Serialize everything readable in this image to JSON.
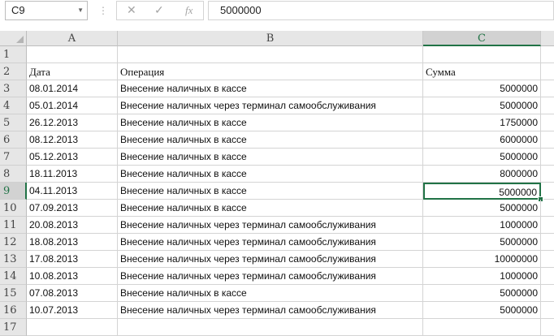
{
  "formula_bar": {
    "name_box": "C9",
    "cancel_icon": "✕",
    "enter_icon": "✓",
    "fx_label": "fx",
    "formula_value": "5000000"
  },
  "columns": [
    "A",
    "B",
    "C"
  ],
  "selected": {
    "col": "C",
    "row": 9
  },
  "rows": [
    {
      "n": "1",
      "date": "",
      "op": "",
      "sum": ""
    },
    {
      "n": "2",
      "date": "Дата",
      "op": "Операция",
      "sum": "Сумма"
    },
    {
      "n": "3",
      "date": "08.01.2014",
      "op": "Внесение наличных в кассе",
      "sum": "5000000"
    },
    {
      "n": "4",
      "date": "05.01.2014",
      "op": "Внесение наличных через терминал самообслуживания",
      "sum": "5000000"
    },
    {
      "n": "5",
      "date": "26.12.2013",
      "op": "Внесение наличных в кассе",
      "sum": "1750000"
    },
    {
      "n": "6",
      "date": "08.12.2013",
      "op": "Внесение наличных в кассе",
      "sum": "6000000"
    },
    {
      "n": "7",
      "date": "05.12.2013",
      "op": "Внесение наличных в кассе",
      "sum": "5000000"
    },
    {
      "n": "8",
      "date": "18.11.2013",
      "op": "Внесение наличных в кассе",
      "sum": "8000000"
    },
    {
      "n": "9",
      "date": "04.11.2013",
      "op": "Внесение наличных в кассе",
      "sum": "5000000"
    },
    {
      "n": "10",
      "date": "07.09.2013",
      "op": "Внесение наличных в кассе",
      "sum": "5000000"
    },
    {
      "n": "11",
      "date": "20.08.2013",
      "op": "Внесение наличных через терминал самообслуживания",
      "sum": "1000000"
    },
    {
      "n": "12",
      "date": "18.08.2013",
      "op": "Внесение наличных через терминал самообслуживания",
      "sum": "5000000"
    },
    {
      "n": "13",
      "date": "17.08.2013",
      "op": "Внесение наличных через терминал самообслуживания",
      "sum": "10000000"
    },
    {
      "n": "14",
      "date": "10.08.2013",
      "op": "Внесение наличных через терминал самообслуживания",
      "sum": "1000000"
    },
    {
      "n": "15",
      "date": "07.08.2013",
      "op": "Внесение наличных в кассе",
      "sum": "5000000"
    },
    {
      "n": "16",
      "date": "10.07.2013",
      "op": "Внесение наличных через терминал самообслуживания",
      "sum": "5000000"
    },
    {
      "n": "17",
      "date": "",
      "op": "",
      "sum": ""
    }
  ]
}
